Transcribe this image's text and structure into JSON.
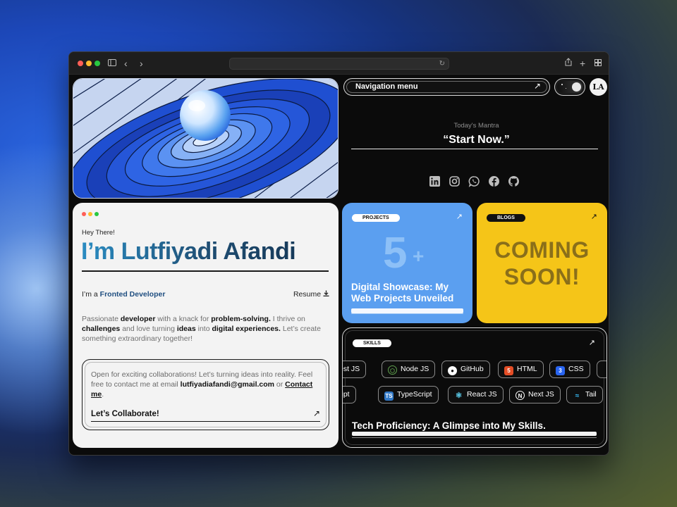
{
  "browser": {
    "traffic_lights": [
      "#ff5f57",
      "#febc2e",
      "#28c840"
    ],
    "toolbar_icons": [
      "sidebar-icon",
      "back-icon",
      "forward-icon",
      "share-icon",
      "new-tab-icon",
      "tab-overview-icon"
    ]
  },
  "nav": {
    "label": "Navigation menu",
    "arrow": "↗",
    "avatar_text": "LA"
  },
  "mantra": {
    "label": "Today's Mantra",
    "text": "“Start Now.”"
  },
  "socials": [
    "linkedin-icon",
    "instagram-icon",
    "whatsapp-icon",
    "facebook-icon",
    "github-icon"
  ],
  "about": {
    "greeting": "Hey There!",
    "name": "I’m Lutfiyadi Afandi",
    "role_prefix": "I’m a ",
    "role": "Fronted Developer",
    "resume": "Resume",
    "bio": {
      "p1": "Passionate ",
      "b1": "developer",
      "p2": " with a knack for ",
      "b2": "problem-solving.",
      "p3": " I thrive on ",
      "b3": "challenges",
      "p4": " and love turning ",
      "b4": "ideas",
      "p5": " into ",
      "b5": "digital experiences.",
      "p6": " Let’s create something extraordinary together!"
    },
    "collab": {
      "text1": "Open for exciting collaborations! Let’s turning ideas into reality. Feel free to contact me at email ",
      "email": "lutfiyadiafandi@gmail.com",
      "text2": " or ",
      "contact_link": "Contact me",
      "text3": ".",
      "cta": "Let’s Collaborate!",
      "arrow": "↗"
    }
  },
  "projects": {
    "tag": "PROJECTS",
    "count": "5",
    "plus": "+",
    "title": "Digital Showcase: My Web Projects Unveiled",
    "arrow": "↗",
    "color": "#5b9ff0"
  },
  "blogs": {
    "tag": "BLOGS",
    "coming_1": "COMING",
    "coming_2": "SOON!",
    "arrow": "↗",
    "color": "#f5c518"
  },
  "skills": {
    "tag": "SKILLS",
    "arrow": "↗",
    "row1": [
      {
        "label": "est JS",
        "icon": ""
      },
      {
        "label": "Node JS",
        "icon": "nodejs-icon"
      },
      {
        "label": "GitHub",
        "icon": "github-icon"
      },
      {
        "label": "HTML",
        "icon": "html5-icon"
      },
      {
        "label": "CSS",
        "icon": "css3-icon"
      }
    ],
    "row2": [
      {
        "label": "ript",
        "icon": ""
      },
      {
        "label": "TypeScript",
        "icon": "typescript-icon"
      },
      {
        "label": "React JS",
        "icon": "react-icon"
      },
      {
        "label": "Next JS",
        "icon": "nextjs-icon"
      },
      {
        "label": "Tail",
        "icon": "tailwind-icon"
      }
    ],
    "title": "Tech Proficiency: A Glimpse into My Skills."
  }
}
